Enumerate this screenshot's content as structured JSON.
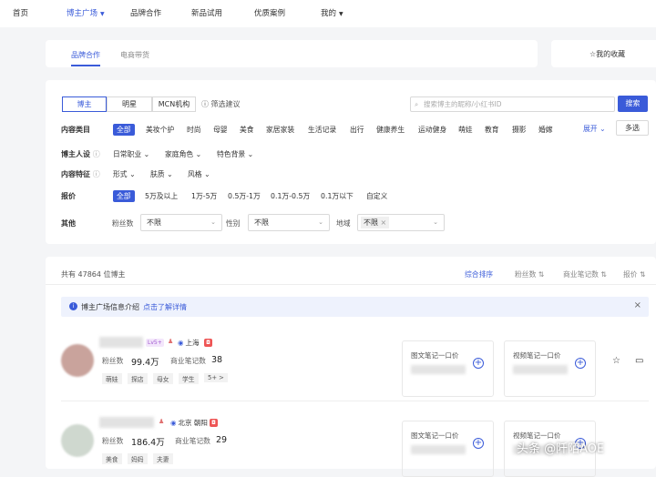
{
  "topnav": {
    "home": "首页",
    "plaza": "博主广场",
    "brand": "品牌合作",
    "trial": "新品试用",
    "cases": "优质案例",
    "mine": "我的"
  },
  "tabs": {
    "brand": "品牌合作",
    "ecom": "电商带货",
    "favorites": "我的收藏"
  },
  "filter": {
    "roles": [
      "博主",
      "明星",
      "MCN机构"
    ],
    "hint": "筛选建议",
    "search_placeholder": "搜索博主的昵称/小红书ID",
    "search_btn": "搜索",
    "content_label": "内容类目",
    "content_opts": [
      "全部",
      "美妆个护",
      "时尚",
      "母婴",
      "美食",
      "家居家装",
      "生活记录",
      "出行",
      "健康养生",
      "运动健身",
      "萌娃",
      "教育",
      "摄影",
      "婚嫁"
    ],
    "expand": "展开",
    "multi": "多选",
    "persona_label": "博主人设",
    "persona_opts": [
      "日常职业",
      "家庭角色",
      "特色背景"
    ],
    "feature_label": "内容特征",
    "feature_opts": [
      "形式",
      "肤质",
      "风格"
    ],
    "price_label": "报价",
    "price_opts": [
      "全部",
      "5万及以上",
      "1万-5万",
      "0.5万-1万",
      "0.1万-0.5万",
      "0.1万以下",
      "自定义"
    ],
    "other_label": "其他",
    "fans_label": "粉丝数",
    "fans_val": "不限",
    "gender_label": "性别",
    "gender_val": "不限",
    "region_label": "地域",
    "region_val": "不限"
  },
  "list": {
    "total": "共有 47864 位博主",
    "sorts": [
      "综合排序",
      "粉丝数",
      "商业笔记数",
      "报价"
    ],
    "info_text": "博主广场信息介绍",
    "info_link": "点击了解详情",
    "bloggers": [
      {
        "level": "Lv5+",
        "location": "上海",
        "fans_label": "粉丝数",
        "fans": "99.4万",
        "notes_label": "商业笔记数",
        "notes": "38",
        "tags": [
          "萌娃",
          "探店",
          "母女",
          "学生",
          "5+ >"
        ],
        "img_price": "图文笔记一口价",
        "video_price": "视频笔记一口价"
      },
      {
        "level": "",
        "location": "北京 朝阳",
        "fans_label": "粉丝数",
        "fans": "186.4万",
        "notes_label": "商业笔记数",
        "notes": "29",
        "tags": [
          "美食",
          "妈妈",
          "夫妻"
        ],
        "img_price": "图文笔记一口价",
        "video_price": "视频笔记一口价"
      }
    ]
  },
  "watermark": "头条 @阡陌AOE"
}
